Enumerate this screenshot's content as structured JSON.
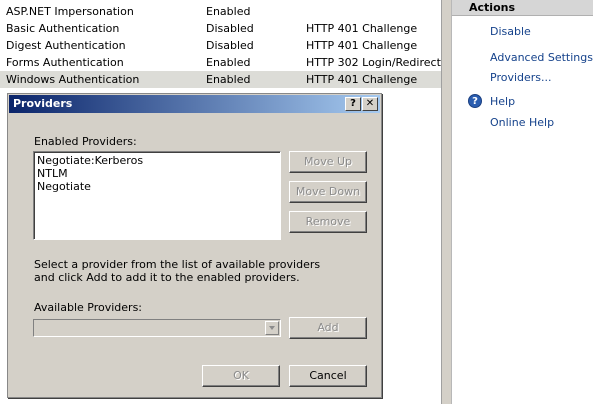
{
  "auth_list": {
    "rows": [
      {
        "name": "ASP.NET Impersonation",
        "status": "Enabled",
        "type": ""
      },
      {
        "name": "Basic Authentication",
        "status": "Disabled",
        "type": "HTTP 401 Challenge"
      },
      {
        "name": "Digest Authentication",
        "status": "Disabled",
        "type": "HTTP 401 Challenge"
      },
      {
        "name": "Forms Authentication",
        "status": "Enabled",
        "type": "HTTP 302 Login/Redirect"
      },
      {
        "name": "Windows Authentication",
        "status": "Enabled",
        "type": "HTTP 401 Challenge"
      }
    ],
    "selected_index": 4
  },
  "actions": {
    "title": "Actions",
    "disable": "Disable",
    "advanced_settings": "Advanced Settings...",
    "providers": "Providers...",
    "help": "Help",
    "online_help": "Online Help",
    "help_icon_glyph": "?"
  },
  "dialog": {
    "title": "Providers",
    "help_button": "?",
    "close_button": "✕",
    "enabled_label": "Enabled Providers:",
    "enabled_providers": [
      "Negotiate:Kerberos",
      "NTLM",
      "Negotiate"
    ],
    "move_up": "Move Up",
    "move_down": "Move Down",
    "remove": "Remove",
    "instructions_line1": "Select a provider from the list of available providers",
    "instructions_line2": "and click Add to add it to the enabled providers.",
    "available_label": "Available Providers:",
    "available_value": "",
    "add": "Add",
    "ok": "OK",
    "cancel": "Cancel"
  },
  "colors": {
    "titlebar_start": "#0a246a",
    "titlebar_end": "#a6caf0",
    "link": "#15428b",
    "dialog_face": "#d4d0c8"
  }
}
